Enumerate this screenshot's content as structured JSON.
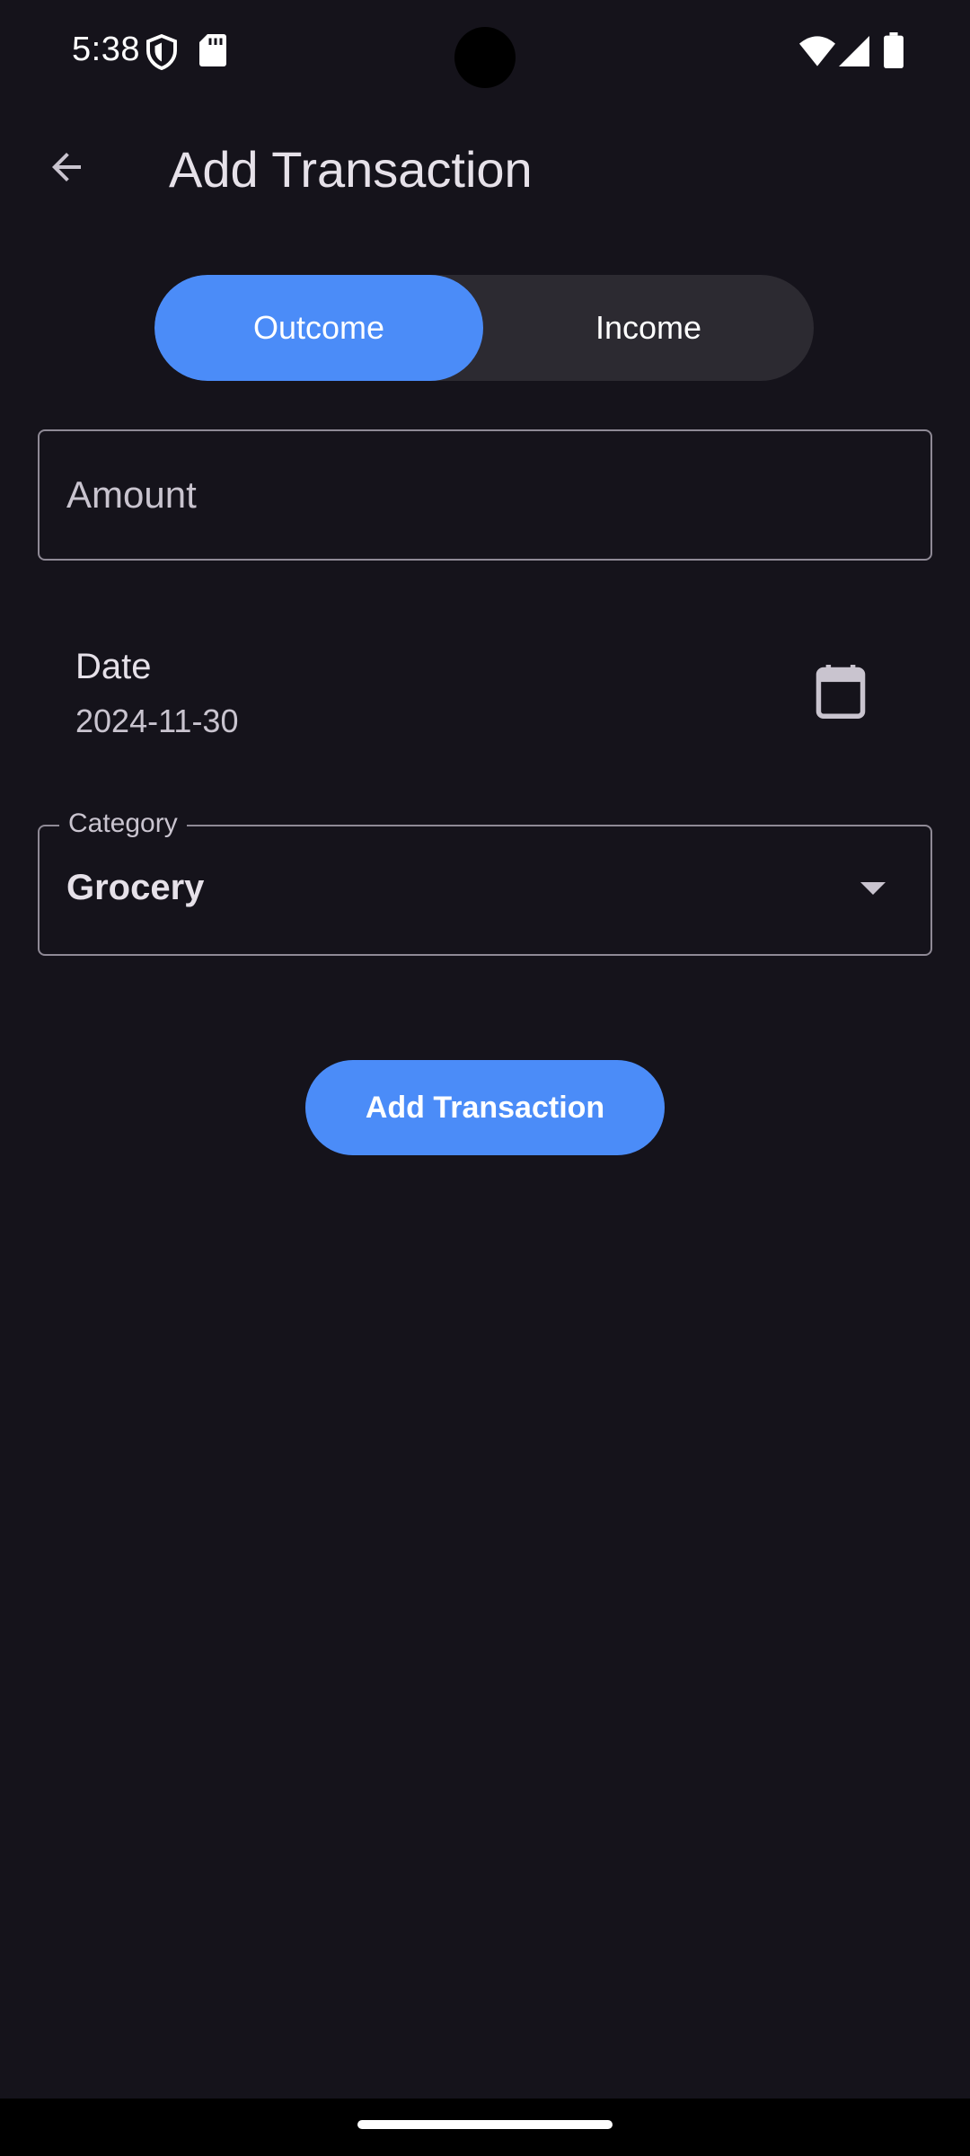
{
  "status_bar": {
    "time": "5:38",
    "icons": [
      "shield-icon",
      "sd-card-icon",
      "wifi-icon",
      "signal-icon",
      "battery-icon"
    ]
  },
  "app_bar": {
    "title": "Add Transaction",
    "back_icon": "arrow-left-icon"
  },
  "type_toggle": {
    "options": [
      "Outcome",
      "Income"
    ],
    "selected": "Outcome"
  },
  "amount": {
    "placeholder": "Amount",
    "value": ""
  },
  "date": {
    "label": "Date",
    "value": "2024-11-30",
    "icon": "calendar-icon"
  },
  "category": {
    "label": "Category",
    "value": "Grocery",
    "icon": "dropdown-arrow-icon"
  },
  "submit": {
    "label": "Add Transaction"
  },
  "colors": {
    "background": "#15131b",
    "accent": "#4b8cf8",
    "segment_bg": "#2c2a31",
    "outline": "#8f8a96",
    "text_primary": "#e6e1e9",
    "text_secondary": "#c9c4cf"
  }
}
